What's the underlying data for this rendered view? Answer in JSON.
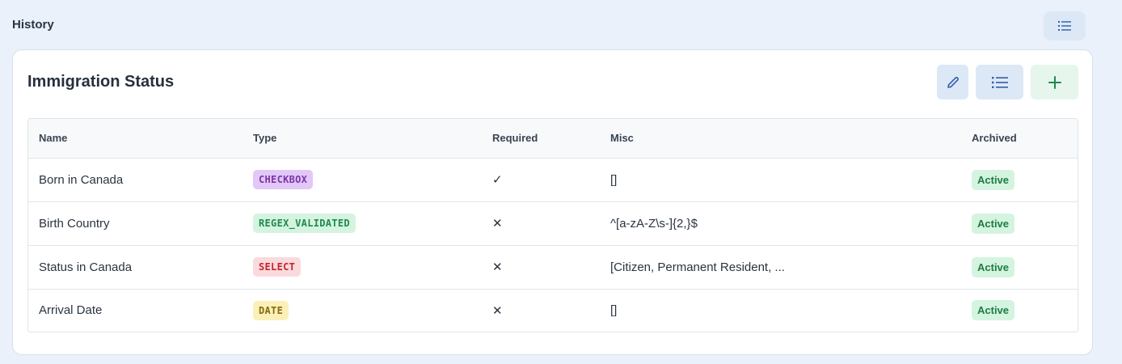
{
  "header": {
    "title": "History",
    "list_icon": "list-icon"
  },
  "card": {
    "title": "Immigration Status",
    "actions": {
      "edit_icon": "pencil-icon",
      "list_icon": "list-icon",
      "add_icon": "plus-icon"
    }
  },
  "table": {
    "columns": [
      "Name",
      "Type",
      "Required",
      "Misc",
      "Archived"
    ],
    "rows": [
      {
        "name": "Born in Canada",
        "type": "CHECKBOX",
        "required": "✓",
        "misc": "[]",
        "archived": "Active"
      },
      {
        "name": "Birth Country",
        "type": "REGEX_VALIDATED",
        "required": "✕",
        "misc": "^[a-zA-Z\\s-]{2,}$",
        "archived": "Active"
      },
      {
        "name": "Status in Canada",
        "type": "SELECT",
        "required": "✕",
        "misc": "[Citizen, Permanent Resident, ...",
        "archived": "Active"
      },
      {
        "name": "Arrival Date",
        "type": "DATE",
        "required": "✕",
        "misc": "[]",
        "archived": "Active"
      }
    ]
  },
  "colors": {
    "page_bg": "#eaf1fa",
    "accent_blue": "#2f5ea8",
    "accent_green": "#1f8a4a"
  }
}
